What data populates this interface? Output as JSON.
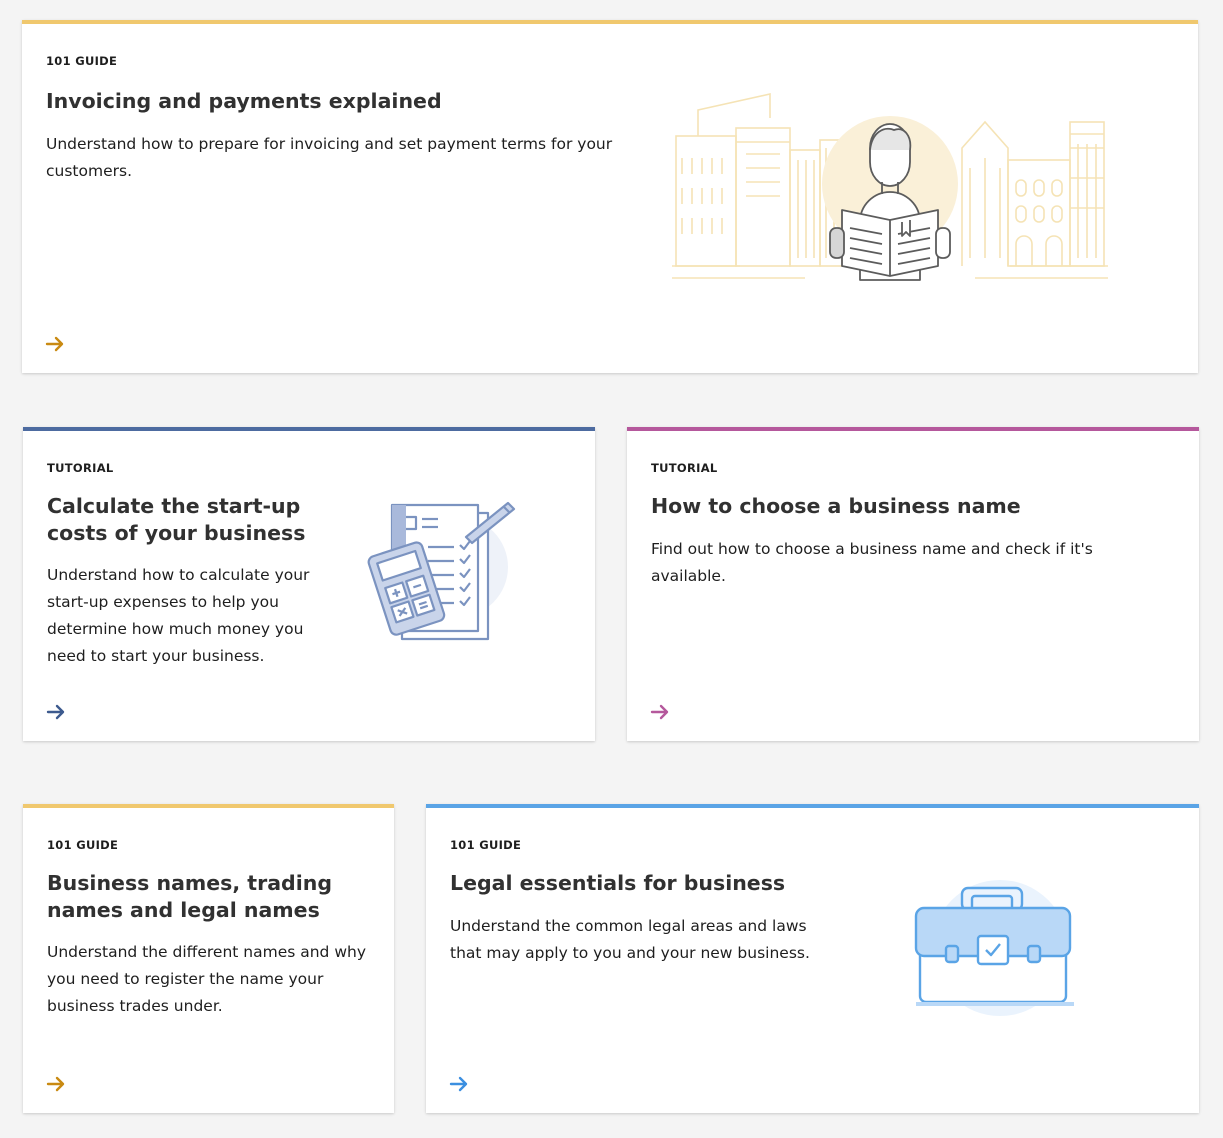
{
  "cards": [
    {
      "tag": "101 GUIDE",
      "title": "Invoicing and payments explained",
      "description": "Understand how to prepare for invoicing and set payment terms for your customers.",
      "accent": "#f0c86e",
      "arrow_color": "#c98a12",
      "illustration": "person-reading-newspaper-city-illustration"
    },
    {
      "tag": "TUTORIAL",
      "title": "Calculate the start-up costs of your business",
      "description": "Understand how to calculate your start-up expenses to help you determine how much money you need to start your business.",
      "accent": "#4d6ba0",
      "arrow_color": "#3d5a8e",
      "illustration": "calculator-checklist-illustration"
    },
    {
      "tag": "TUTORIAL",
      "title": "How to choose a business name",
      "description": "Find out how to choose a business name and check if it's available.",
      "accent": "#b5589c",
      "arrow_color": "#b5589c"
    },
    {
      "tag": "101 GUIDE",
      "title": "Business names, trading names and legal names",
      "description": "Understand the different names and why you need to register the name your business trades under.",
      "accent": "#f0c86e",
      "arrow_color": "#c98a12"
    },
    {
      "tag": "101 GUIDE",
      "title": "Legal essentials for business",
      "description": "Understand the common legal areas and laws that may apply to you and your new business.",
      "accent": "#5aa4e6",
      "arrow_color": "#3b8fe0",
      "illustration": "briefcase-illustration"
    }
  ]
}
